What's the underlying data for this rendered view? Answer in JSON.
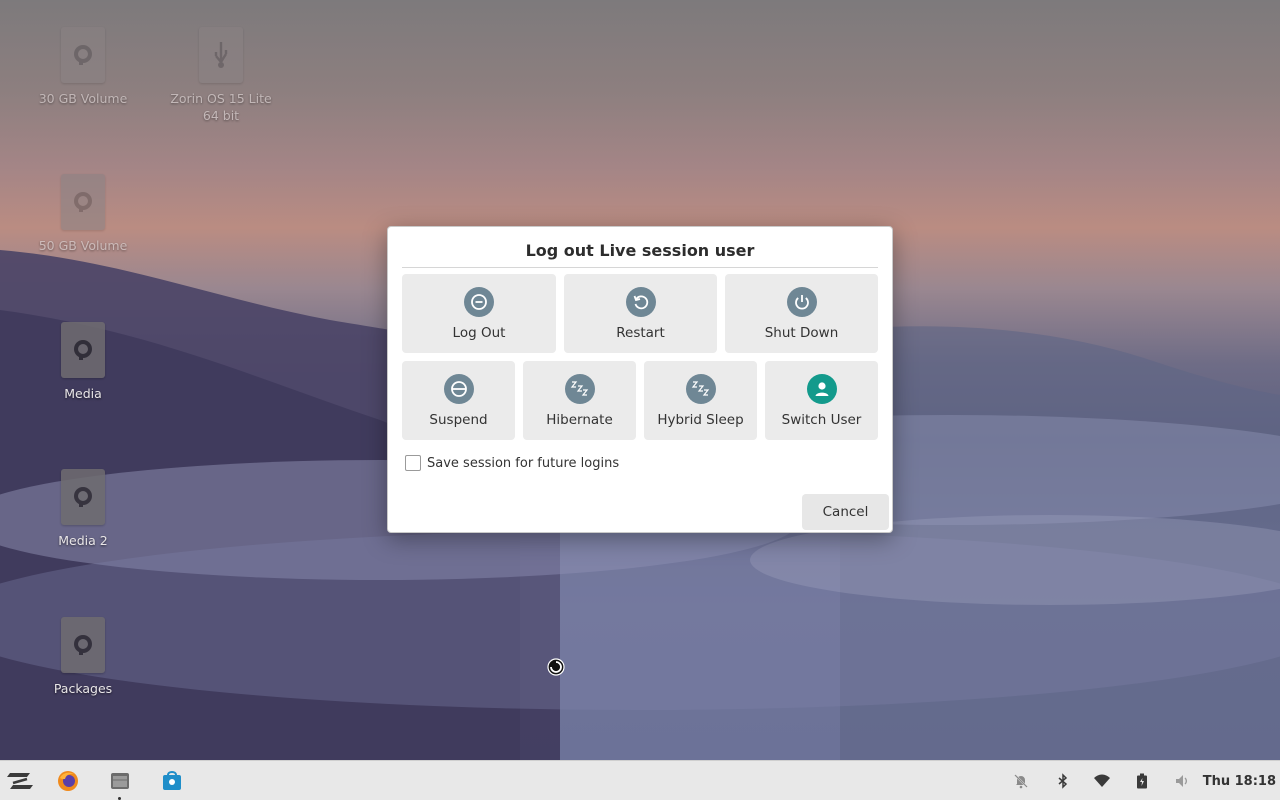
{
  "desktop": {
    "icons": [
      {
        "label": "30 GB Volume",
        "icon": "drive-icon"
      },
      {
        "label": "Zorin OS 15 Lite 64 bit",
        "icon": "usb-drive-icon"
      },
      {
        "label": "50 GB Volume",
        "icon": "drive-icon"
      },
      {
        "label": "Media",
        "icon": "drive-icon"
      },
      {
        "label": "Media 2",
        "icon": "drive-icon"
      },
      {
        "label": "Packages",
        "icon": "drive-icon"
      }
    ]
  },
  "dialog": {
    "title": "Log out Live session user",
    "options_row1": [
      {
        "label": "Log Out",
        "icon": "logout-icon"
      },
      {
        "label": "Restart",
        "icon": "restart-icon"
      },
      {
        "label": "Shut Down",
        "icon": "power-icon"
      }
    ],
    "options_row2": [
      {
        "label": "Suspend",
        "icon": "suspend-icon"
      },
      {
        "label": "Hibernate",
        "icon": "sleep-icon"
      },
      {
        "label": "Hybrid Sleep",
        "icon": "sleep-icon"
      },
      {
        "label": "Switch User",
        "icon": "user-icon"
      }
    ],
    "save_session_label": "Save session for future logins",
    "save_session_checked": false,
    "cancel_label": "Cancel"
  },
  "taskbar": {
    "apps": [
      "zorin-menu-icon",
      "firefox-icon",
      "files-icon",
      "software-store-icon"
    ],
    "tray": [
      "notifications-off-icon",
      "bluetooth-icon",
      "wifi-icon",
      "battery-icon",
      "volume-icon"
    ],
    "clock": "Thu 18:18"
  },
  "colors": {
    "dialog_bg": "#ffffff",
    "option_bg": "#ebebeb",
    "icon_gray": "#6f8795",
    "icon_teal": "#139a8c",
    "taskbar_bg": "#e8e8e8"
  }
}
